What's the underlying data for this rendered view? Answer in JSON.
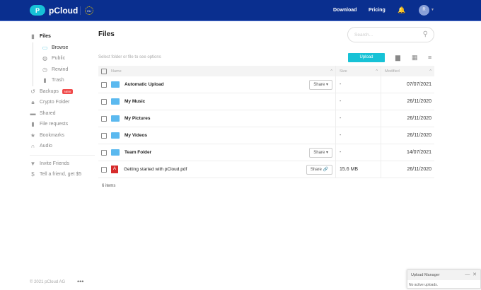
{
  "header": {
    "logo": "pCloud",
    "logo_glyph": "P",
    "region": "EU",
    "download": "Download",
    "pricing": "Pricing",
    "avatar": "R"
  },
  "sidebar": {
    "files": "Files",
    "sub": [
      "Browse",
      "Public",
      "Rewind",
      "Trash"
    ],
    "items": [
      {
        "label": "Backups",
        "badge": "NEW"
      },
      {
        "label": "Crypto Folder"
      },
      {
        "label": "Shared"
      },
      {
        "label": "File requests"
      },
      {
        "label": "Bookmarks"
      },
      {
        "label": "Audio"
      }
    ],
    "extra": [
      "Invite Friends",
      "Tell a friend, get $5"
    ],
    "footer": "© 2021 pCloud AG"
  },
  "main": {
    "title": "Files",
    "search_placeholder": "Search...",
    "hint": "Select folder or file to see options",
    "upload": "Upload",
    "columns": {
      "name": "Name",
      "size": "Size",
      "modified": "Modified"
    },
    "rows": [
      {
        "name": "Automatic Upload",
        "size": "-",
        "modified": "07/07/2021",
        "share": "Share ▾"
      },
      {
        "name": "My Music",
        "size": "-",
        "modified": "26/11/2020"
      },
      {
        "name": "My Pictures",
        "size": "-",
        "modified": "26/11/2020"
      },
      {
        "name": "My Videos",
        "size": "-",
        "modified": "26/11/2020"
      },
      {
        "name": "Team Folder",
        "size": "-",
        "modified": "14/07/2021",
        "share": "Share ▾"
      },
      {
        "name": "Getting started with pCloud.pdf",
        "size": "15.6 MB",
        "modified": "26/11/2020",
        "share": "Share 🔗"
      }
    ],
    "count": "6 items"
  },
  "upload_manager": {
    "title": "Upload Manager",
    "status": "No active uploads."
  }
}
